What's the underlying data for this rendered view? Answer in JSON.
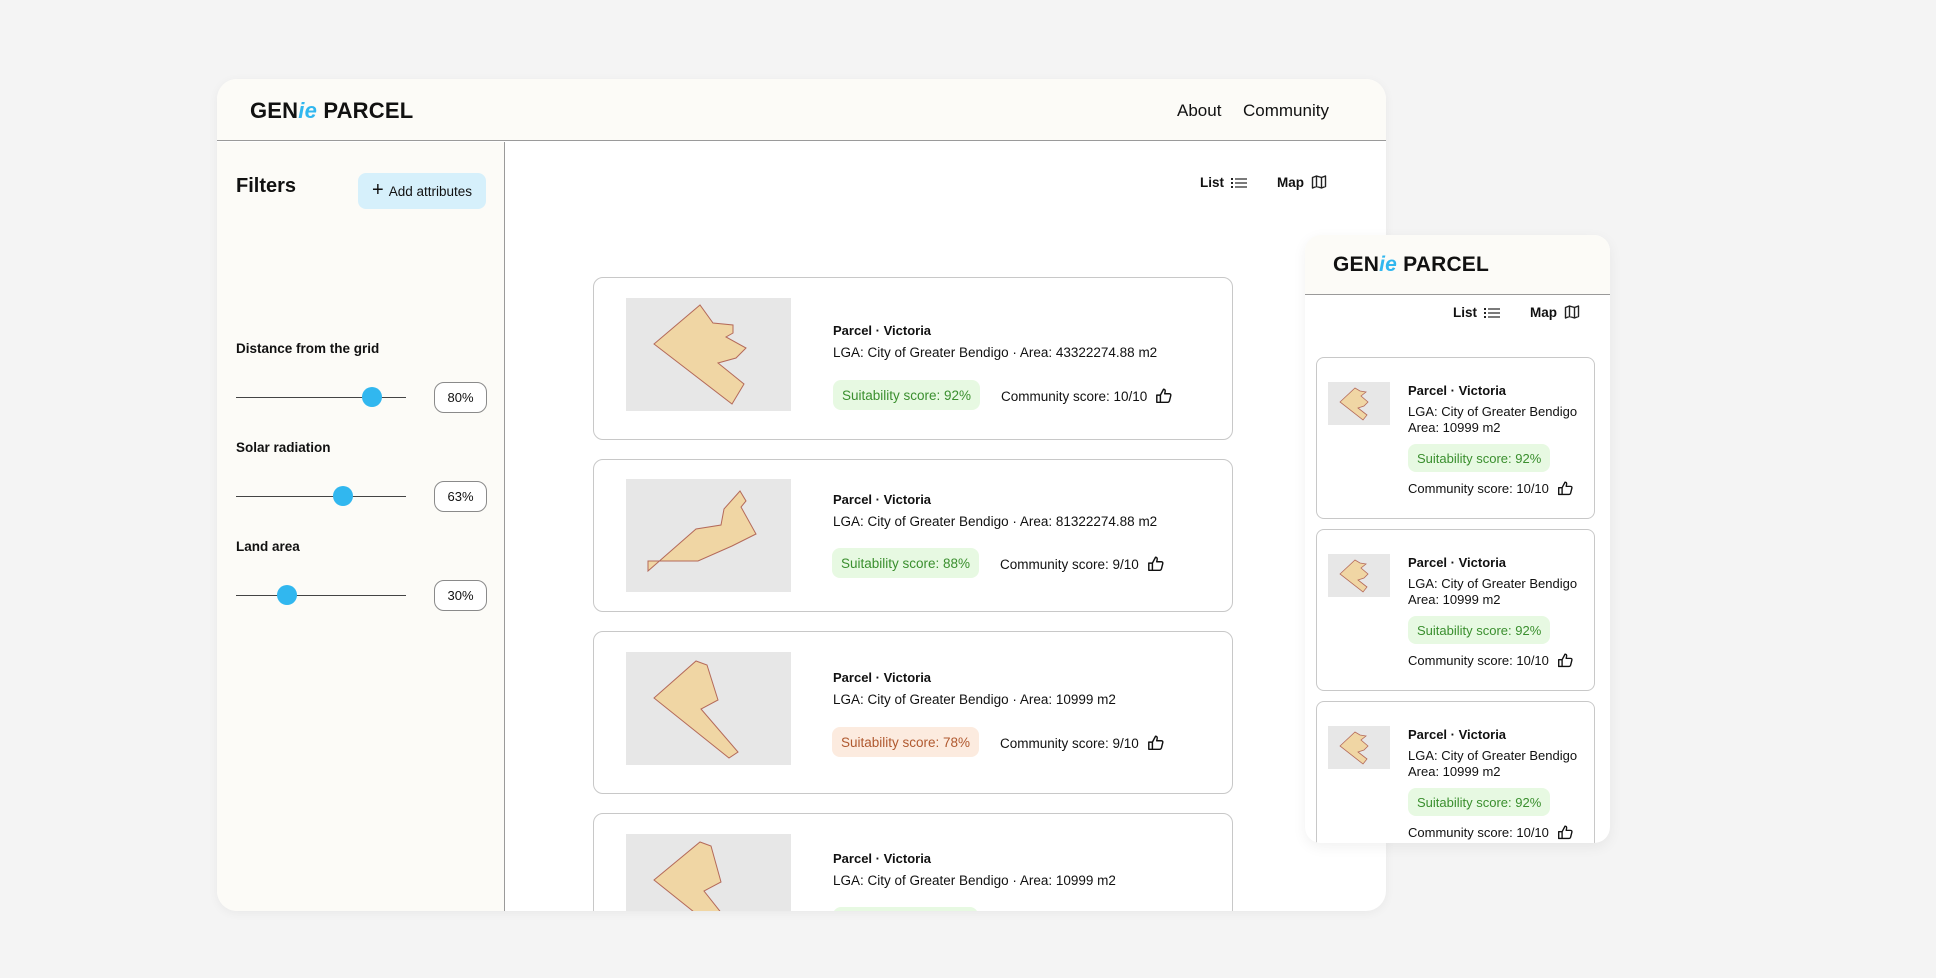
{
  "brand": {
    "logo_pre": "GEN",
    "logo_ie": "ie",
    "logo_post": " PARCEL"
  },
  "nav": {
    "about": "About",
    "community": "Community"
  },
  "view": {
    "list": "List",
    "map": "Map"
  },
  "filters": {
    "title": "Filters",
    "add_button": "Add attributes",
    "items": [
      {
        "label": "Distance from the grid",
        "value": 80,
        "value_text": "80%"
      },
      {
        "label": "Solar radiation",
        "value": 63,
        "value_text": "63%"
      },
      {
        "label": "Land area",
        "value": 30,
        "value_text": "30%"
      }
    ]
  },
  "parcels": [
    {
      "title": "Parcel · Victoria",
      "lga": "LGA: City of Greater Bendigo · Area: 43322274.88 m2",
      "suitability": "Suitability score: 92%",
      "status": "good",
      "community": "Community score: 10/10"
    },
    {
      "title": "Parcel · Victoria",
      "lga": "LGA: City of Greater Bendigo · Area: 81322274.88 m2",
      "suitability": "Suitability score: 88%",
      "status": "good",
      "community": "Community score: 9/10"
    },
    {
      "title": "Parcel · Victoria",
      "lga": "LGA: City of Greater Bendigo · Area: 10999 m2",
      "suitability": "Suitability score: 78%",
      "status": "warn",
      "community": "Community score: 9/10"
    },
    {
      "title": "Parcel · Victoria",
      "lga": "LGA: City of Greater Bendigo · Area: 10999 m2",
      "suitability": "",
      "status": "good",
      "community": ""
    }
  ],
  "mobile_parcels": [
    {
      "title": "Parcel · Victoria",
      "lga": "LGA: City of Greater Bendigo",
      "area": "Area: 10999 m2",
      "suitability": "Suitability score: 92%",
      "community": "Community score: 10/10"
    },
    {
      "title": "Parcel · Victoria",
      "lga": "LGA: City of Greater Bendigo",
      "area": "Area: 10999 m2",
      "suitability": "Suitability score: 92%",
      "community": "Community score: 10/10"
    },
    {
      "title": "Parcel · Victoria",
      "lga": "LGA: City of Greater Bendigo",
      "area": "Area: 10999 m2",
      "suitability": "Suitability score: 92%",
      "community": "Community score: 10/10"
    }
  ],
  "colors": {
    "accent": "#31b7ef",
    "parcel_fill": "#f0d6a4",
    "parcel_stroke": "#b46a5a",
    "good_text": "#3a8f2e",
    "warn_text": "#b0592f"
  }
}
